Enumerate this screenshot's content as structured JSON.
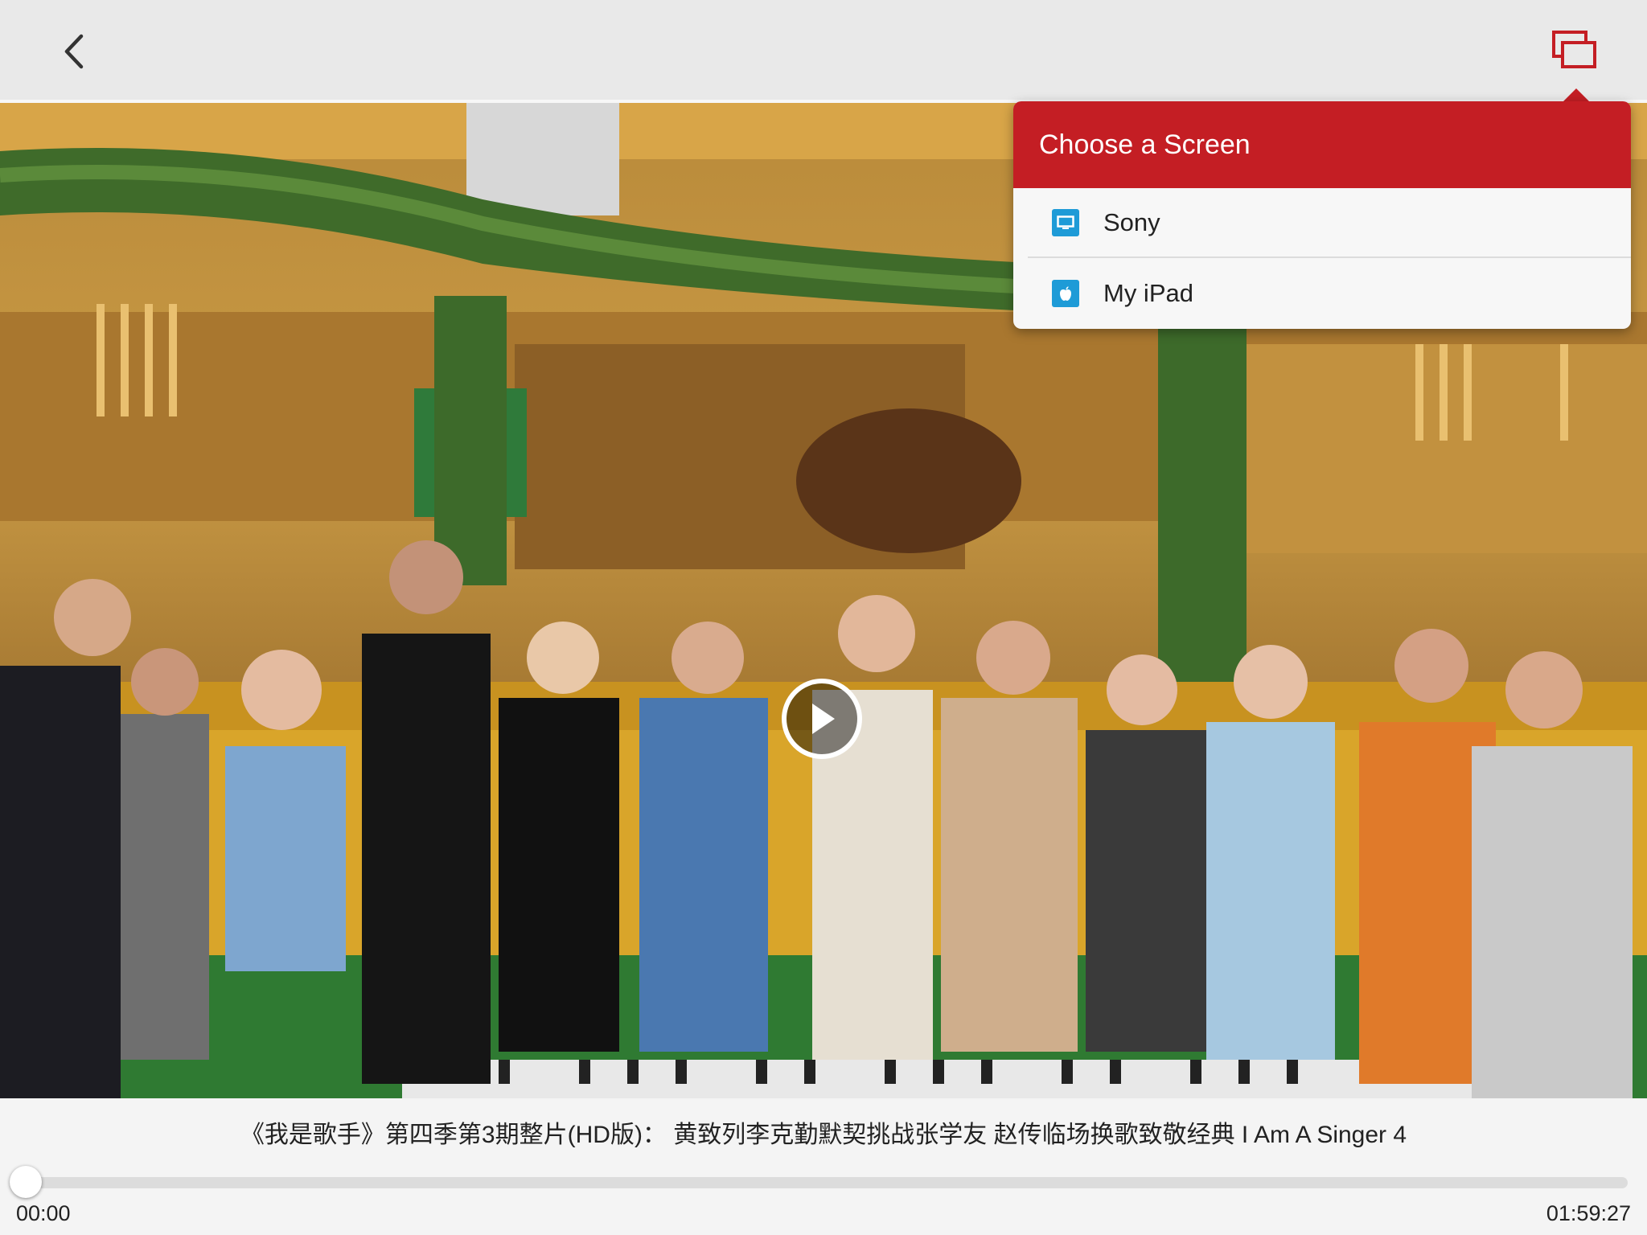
{
  "cast_menu": {
    "header": "Choose a Screen",
    "devices": [
      {
        "label": "Sony",
        "icon": "tv-icon"
      },
      {
        "label": "My iPad",
        "icon": "apple-icon"
      }
    ]
  },
  "video": {
    "title": "《我是歌手》第四季第3期整片(HD版)： 黄致列李克勤默契挑战张学友 赵传临场换歌致敬经典 I Am A Singer 4",
    "current_time": "00:00",
    "duration": "01:59:27",
    "progress": 0
  },
  "colors": {
    "accent": "#c41e24",
    "device_icon": "#1e9bd7"
  }
}
